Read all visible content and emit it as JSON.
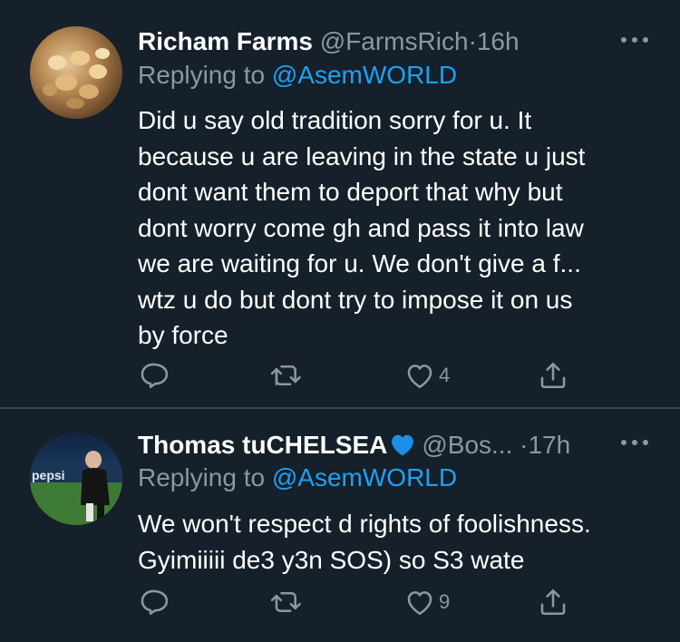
{
  "tweets": [
    {
      "name": "Richam Farms",
      "handle": "@FarmsRich",
      "separator": "·",
      "time": "16h",
      "replying_prefix": "Replying to",
      "replying_to": "@AsemWORLD",
      "body_lines": [
        "Did u say old tradition sorry for u. It",
        "because u are leaving in the state u just",
        "dont want them to deport that why but",
        "dont worry come gh and pass it into law",
        "we are waiting for u. We don't give a f...",
        "wtz u do but dont try to impose it on us",
        "by force"
      ],
      "like_count": "4",
      "avatar_icon": "baby-chicks-photo"
    },
    {
      "name": "Thomas tuCHELSEA",
      "name_badge_icon": "blue-heart-emoji",
      "handle": "@Bos...",
      "separator": "·",
      "time": "17h",
      "replying_prefix": "Replying to",
      "replying_to": "@AsemWORLD",
      "body_lines": [
        "We won't respect d rights of foolishness.",
        "Gyimiiiii de3 y3n SOS) so S3 wate"
      ],
      "like_count": "9",
      "avatar_icon": "coach-photo"
    }
  ],
  "icons": {
    "more": "more-dots-icon",
    "reply": "reply-icon",
    "retweet": "retweet-icon",
    "like": "heart-icon",
    "share": "share-icon"
  },
  "colors": {
    "background": "#15202b",
    "muted": "#8899a6",
    "link": "#1da1f2",
    "divider": "#38444d"
  }
}
